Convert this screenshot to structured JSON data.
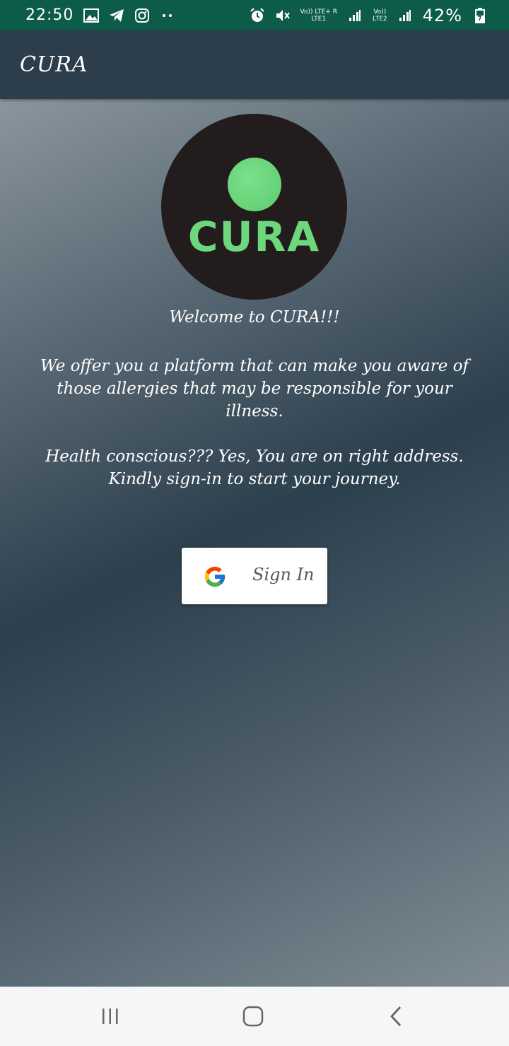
{
  "status_bar": {
    "time": "22:50",
    "left_icons": [
      "image-icon",
      "telegram-icon",
      "instagram-icon",
      "more-dots-icon"
    ],
    "network_lte1": "Vo)) LTE+ R",
    "network_lte1_sub": "LTE1",
    "network_lte2": "Vo))",
    "network_lte2_sub": "LTE2",
    "battery": "42%"
  },
  "app_bar": {
    "title": "CURA"
  },
  "logo": {
    "text": "CURA"
  },
  "content": {
    "welcome": "Welcome to CURA!!!",
    "paragraph1": "We offer you a platform that can make you aware of those allergies that may be responsible for your illness.",
    "paragraph2": "Health conscious??? Yes, You are on right address. Kindly sign-in to start your journey."
  },
  "signin": {
    "label": "Sign In"
  },
  "colors": {
    "status_bar": "#0d5c4a",
    "app_bar": "#2c3e4c",
    "logo_bg": "#231c1d",
    "logo_green": "#6cd77c"
  }
}
